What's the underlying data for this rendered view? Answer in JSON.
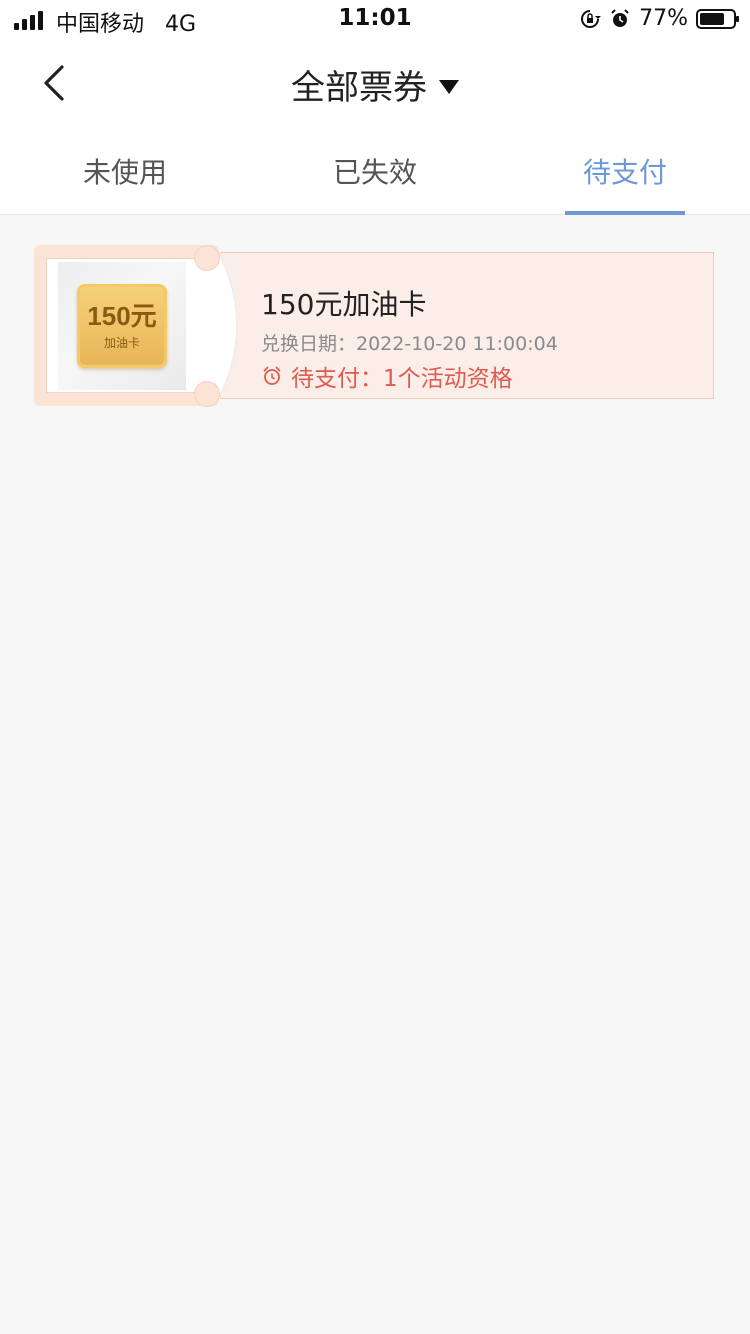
{
  "status_bar": {
    "carrier": "中国移动",
    "network": "4G",
    "time": "11:01",
    "battery_percent": "77%",
    "battery_level": 0.77
  },
  "navbar": {
    "title": "全部票券"
  },
  "tabs": [
    {
      "label": "未使用",
      "active": false
    },
    {
      "label": "已失效",
      "active": false
    },
    {
      "label": "待支付",
      "active": true
    }
  ],
  "tickets": [
    {
      "badge_amount": "150元",
      "badge_subtitle": "加油卡",
      "name": "150元加油卡",
      "date": "兑换日期：2022-10-20 11:00:04",
      "status": "待支付：1个活动资格"
    }
  ],
  "colors": {
    "accent": "#6d9ad6",
    "status_red": "#e05a4f",
    "ticket_bg": "#fbeee9"
  }
}
